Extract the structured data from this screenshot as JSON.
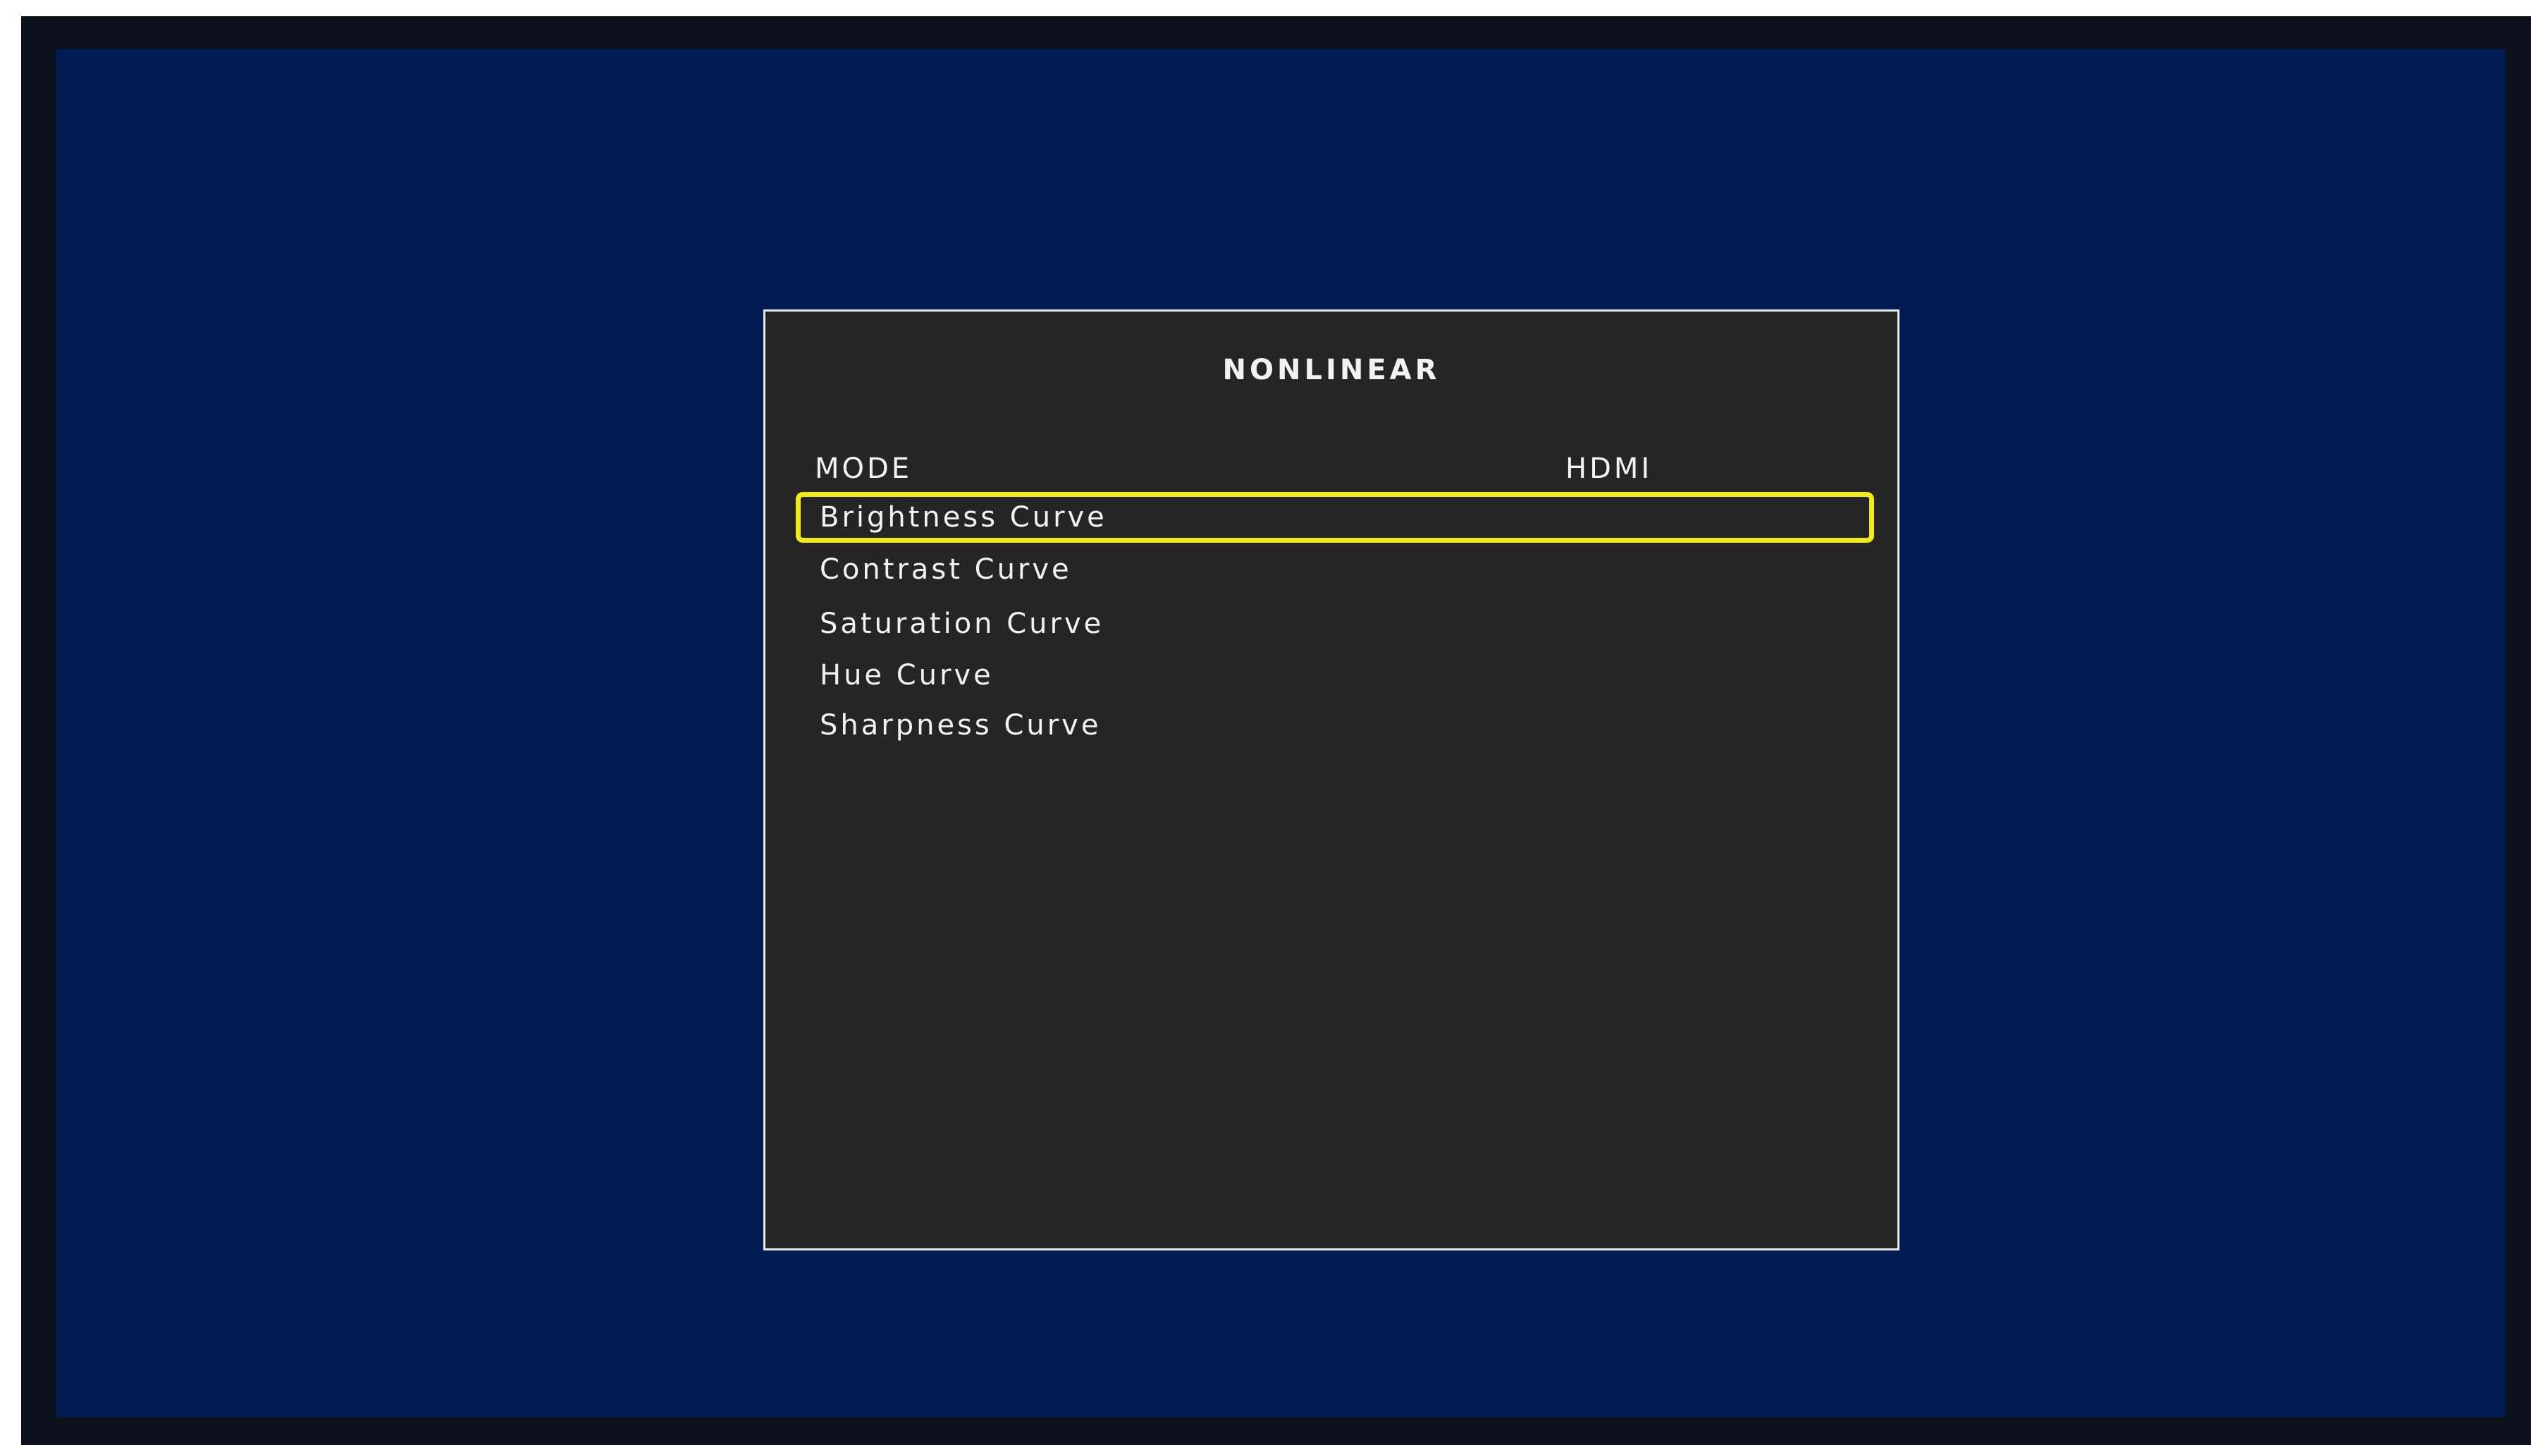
{
  "osd": {
    "title": "NONLINEAR",
    "mode_row": {
      "label": "MODE",
      "value": "HDMI"
    },
    "items": [
      {
        "label": "Brightness Curve",
        "selected": true
      },
      {
        "label": "Contrast Curve",
        "selected": false
      },
      {
        "label": "Saturation Curve",
        "selected": false
      },
      {
        "label": "Hue Curve",
        "selected": false
      },
      {
        "label": "Sharpness Curve",
        "selected": false
      }
    ]
  },
  "colors": {
    "screen_background": "#001c52",
    "bezel": "#0b121b",
    "panel_background": "#252525",
    "panel_border": "#e8e8e8",
    "text": "#f2f2f2",
    "selection_highlight": "#f3ea17"
  }
}
